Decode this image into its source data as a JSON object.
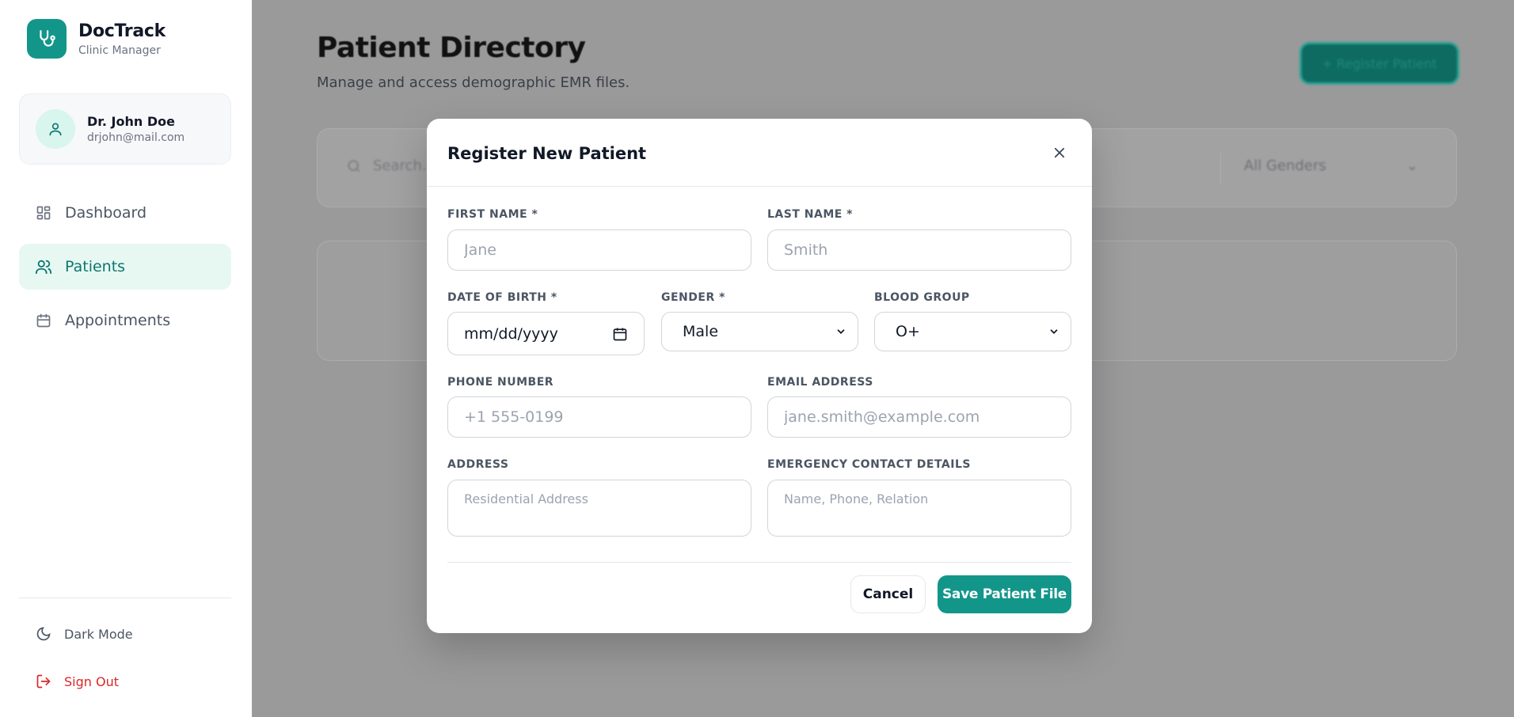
{
  "brand": {
    "name": "DocTrack",
    "subtitle": "Clinic Manager"
  },
  "user": {
    "name": "Dr. John Doe",
    "email": "drjohn@mail.com"
  },
  "nav": [
    {
      "label": "Dashboard",
      "icon": "grid-icon",
      "active": false
    },
    {
      "label": "Patients",
      "icon": "users-icon",
      "active": true
    },
    {
      "label": "Appointments",
      "icon": "calendar-icon",
      "active": false
    }
  ],
  "sidebar_footer": {
    "dark_mode": "Dark Mode",
    "sign_out": "Sign Out"
  },
  "page": {
    "title": "Patient Directory",
    "subtitle": "Manage and access demographic EMR files.",
    "register_button": "+ Register Patient",
    "search_placeholder": "Search...",
    "gender_filter": "All Genders"
  },
  "modal": {
    "title": "Register New Patient",
    "fields": {
      "first_name": {
        "label": "FIRST NAME *",
        "placeholder": "Jane"
      },
      "last_name": {
        "label": "LAST NAME *",
        "placeholder": "Smith"
      },
      "dob": {
        "label": "DATE OF BIRTH *",
        "value": "mm/dd/yyyy"
      },
      "gender": {
        "label": "GENDER *",
        "value": "Male"
      },
      "blood_group": {
        "label": "BLOOD GROUP",
        "value": "O+"
      },
      "phone": {
        "label": "PHONE NUMBER",
        "placeholder": "+1 555-0199"
      },
      "email": {
        "label": "EMAIL ADDRESS",
        "placeholder": "jane.smith@example.com"
      },
      "address": {
        "label": "ADDRESS",
        "placeholder": "Residential Address"
      },
      "emergency": {
        "label": "EMERGENCY CONTACT DETAILS",
        "placeholder": "Name, Phone, Relation"
      }
    },
    "cancel_label": "Cancel",
    "save_label": "Save Patient File"
  },
  "colors": {
    "accent": "#13968a",
    "accent_light": "#e7f8f3",
    "danger": "#dc2626",
    "overlay": "#9a9a9b"
  }
}
